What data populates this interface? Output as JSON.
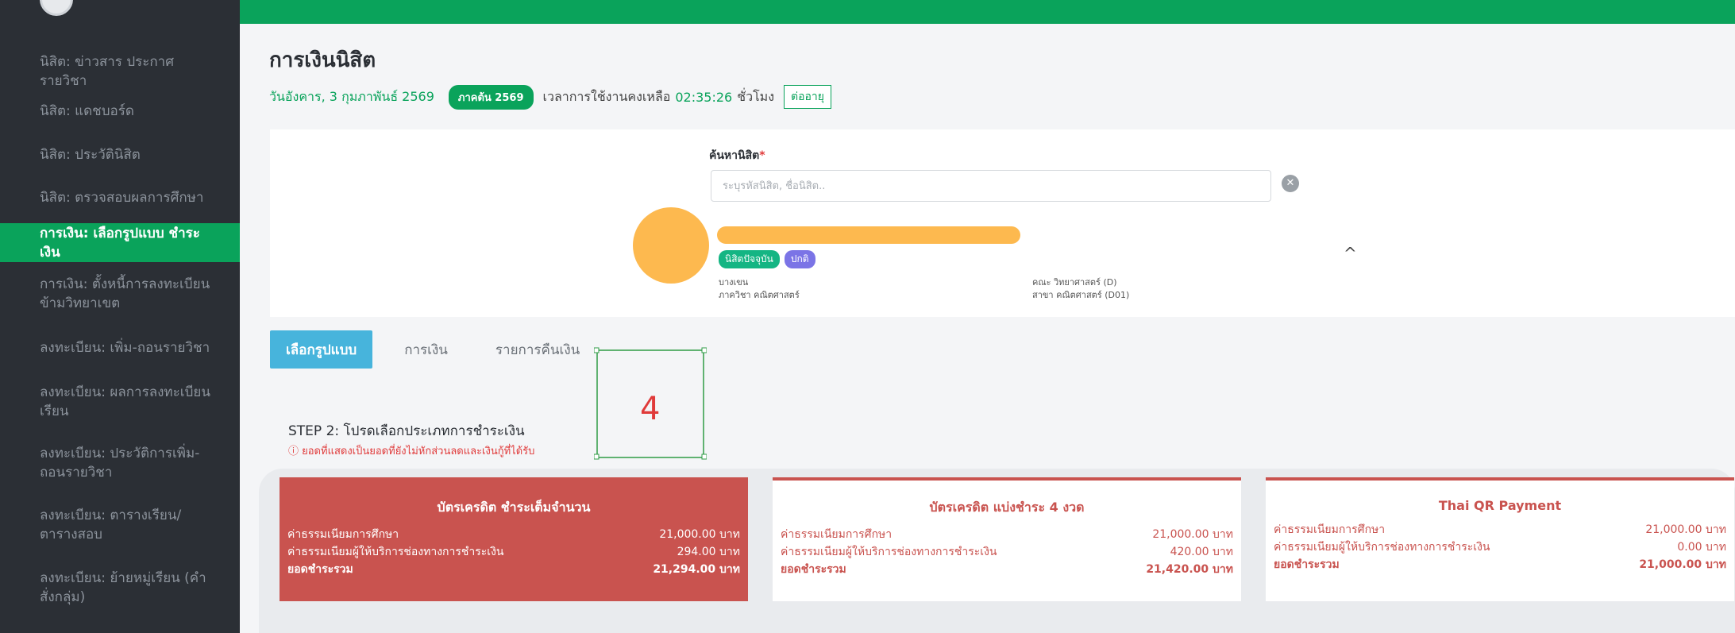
{
  "sidebar": {
    "items": [
      {
        "label": "นิสิต: ข่าวสาร ประกาศรายวิชา"
      },
      {
        "label": "นิสิต: แดชบอร์ด"
      },
      {
        "label": "นิสิต: ประวัตินิสิต"
      },
      {
        "label": "นิสิต: ตรวจสอบผลการศึกษา"
      },
      {
        "label": "การเงิน: เลือกรูปแบบ ชำระเงิน"
      },
      {
        "label": "การเงิน: ตั้งหนี้การลงทะเบียนข้ามวิทยาเขต"
      },
      {
        "label": "ลงทะเบียน: เพิ่ม-ถอนรายวิชา"
      },
      {
        "label": "ลงทะเบียน: ผลการลงทะเบียนเรียน"
      },
      {
        "label": "ลงทะเบียน: ประวัติการเพิ่ม-ถอนรายวิชา"
      },
      {
        "label": "ลงทะเบียน: ตารางเรียน/ตารางสอบ"
      },
      {
        "label": "ลงทะเบียน: ย้ายหมู่เรียน (คำสั่งกลุ่ม)"
      }
    ]
  },
  "header": {
    "title": "การเงินนิสิต",
    "date": "วันอังคาร, 3 กุมภาพันธ์ 2569",
    "term_badge": "ภาคต้น 2569",
    "session_label": "เวลาการใช้งานคงเหลือ",
    "session_time": "02:35:26",
    "session_unit": "ชั่วโมง",
    "extend_label": "ต่ออายุ"
  },
  "student": {
    "search_label": "ค้นหานิสิต",
    "required_mark": "*",
    "search_placeholder": "ระบุรหัสนิสิต, ชื่อนิสิต..",
    "badges": {
      "status": "นิสิตปัจจุบัน",
      "type": "ปกติ"
    },
    "campus": "บางเขน",
    "department": "ภาควิชา คณิตศาสตร์",
    "faculty": "คณะ วิทยาศาสตร์ (D)",
    "major": "สาขา คณิตศาสตร์ (D01)"
  },
  "tabs": [
    {
      "label": "เลือกรูปแบบ"
    },
    {
      "label": "การเงิน"
    },
    {
      "label": "รายการคืนเงิน"
    }
  ],
  "annotation": {
    "number": "4"
  },
  "step": {
    "title": "STEP 2: โปรดเลือกประเภทการชำระเงิน",
    "note": "ⓘ ยอดที่แสดงเป็นยอดที่ยังไม่หักส่วนลดและเงินกู้ที่ได้รับ"
  },
  "payments": [
    {
      "title": "บัตรเครดิต ชำระเต็มจำนวน",
      "tuition_label": "ค่าธรรมเนียมการศึกษา",
      "tuition": "21,000.00 บาท",
      "fee_label": "ค่าธรรมเนียมผู้ให้บริการช่องทางการชำระเงิน",
      "fee": "294.00 บาท",
      "total_label": "ยอดชำระรวม",
      "total": "21,294.00 บาท"
    },
    {
      "title": "บัตรเครดิต แบ่งชำระ 4 งวด",
      "tuition_label": "ค่าธรรมเนียมการศึกษา",
      "tuition": "21,000.00 บาท",
      "fee_label": "ค่าธรรมเนียมผู้ให้บริการช่องทางการชำระเงิน",
      "fee": "420.00 บาท",
      "total_label": "ยอดชำระรวม",
      "total": "21,420.00 บาท"
    },
    {
      "title": "Thai QR Payment",
      "tuition_label": "ค่าธรรมเนียมการศึกษา",
      "tuition": "21,000.00 บาท",
      "fee_label": "ค่าธรรมเนียมผู้ให้บริการช่องทางการชำระเงิน",
      "fee": "0.00 บาท",
      "total_label": "ยอดชำระรวม",
      "total": "21,000.00 บาท"
    }
  ],
  "colors": {
    "accent": "#0aa35b",
    "sidebar": "#2b2f35",
    "payment": "#c9534f",
    "tab_active": "#47b4dc"
  }
}
